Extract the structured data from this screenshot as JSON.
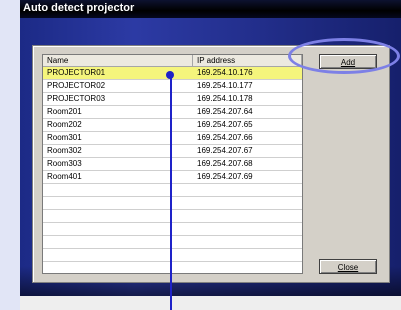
{
  "window": {
    "title": "Auto detect projector"
  },
  "list": {
    "columns": [
      "Name",
      "IP address"
    ],
    "rows": [
      {
        "name": "PROJECTOR01",
        "ip": "169.254.10.176",
        "selected": true
      },
      {
        "name": "PROJECTOR02",
        "ip": "169.254.10.177"
      },
      {
        "name": "PROJECTOR03",
        "ip": "169.254.10.178"
      },
      {
        "name": "Room201",
        "ip": "169.254.207.64"
      },
      {
        "name": "Room202",
        "ip": "169.254.207.65"
      },
      {
        "name": "Room301",
        "ip": "169.254.207.66"
      },
      {
        "name": "Room302",
        "ip": "169.254.207.67"
      },
      {
        "name": "Room303",
        "ip": "169.254.207.68"
      },
      {
        "name": "Room401",
        "ip": "169.254.207.69"
      }
    ]
  },
  "buttons": {
    "add": "Add",
    "close": "Close"
  },
  "colors": {
    "selection": "#f5f57c",
    "annotation": "#1e22c8",
    "highlight_ring": "#7d80e6",
    "window_body": "#2c3aa4"
  }
}
